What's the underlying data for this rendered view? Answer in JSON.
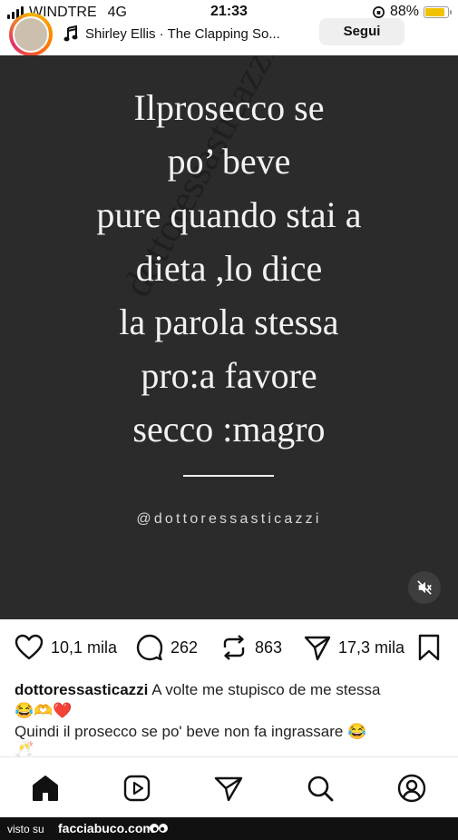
{
  "status_bar": {
    "carrier": "WINDTRE",
    "network": "4G",
    "time": "21:33",
    "battery": "88%",
    "battery_level": 0.88
  },
  "post_header": {
    "music_text": "Shirley Ellis · The Clapping So...",
    "follow_label": "Segui"
  },
  "post": {
    "quote_lines": "Ilprosecco se\npo’ beve\npure quando stai a\ndieta ,lo dice\nla parola stessa\npro:a favore\nsecco :magro",
    "watermark": "dottoressasticazzi",
    "handle": "@dottoressasticazzi"
  },
  "actions": {
    "likes": "10,1 mila",
    "comments": "262",
    "reposts": "863",
    "shares": "17,3 mila"
  },
  "caption": {
    "username": "dottoressasticazzi",
    "line1": "A volte me stupisco de me stessa",
    "emoji1": "😂🫶❤️",
    "line2": "Quindi il prosecco se po' beve non fa ingrassare",
    "emoji2": "😂",
    "emoji3": "🥂"
  },
  "footer": {
    "visto_su": "visto su",
    "site": "facciabuco.com"
  },
  "icons": {
    "heart": "heart-icon",
    "comment": "comment-icon",
    "repost": "repost-icon",
    "share": "share-icon",
    "bookmark": "bookmark-icon",
    "home": "home-icon",
    "reels": "reels-icon",
    "send": "send-icon",
    "search": "search-icon",
    "profile": "profile-icon",
    "mute": "mute-icon",
    "music": "music-note-icon"
  }
}
